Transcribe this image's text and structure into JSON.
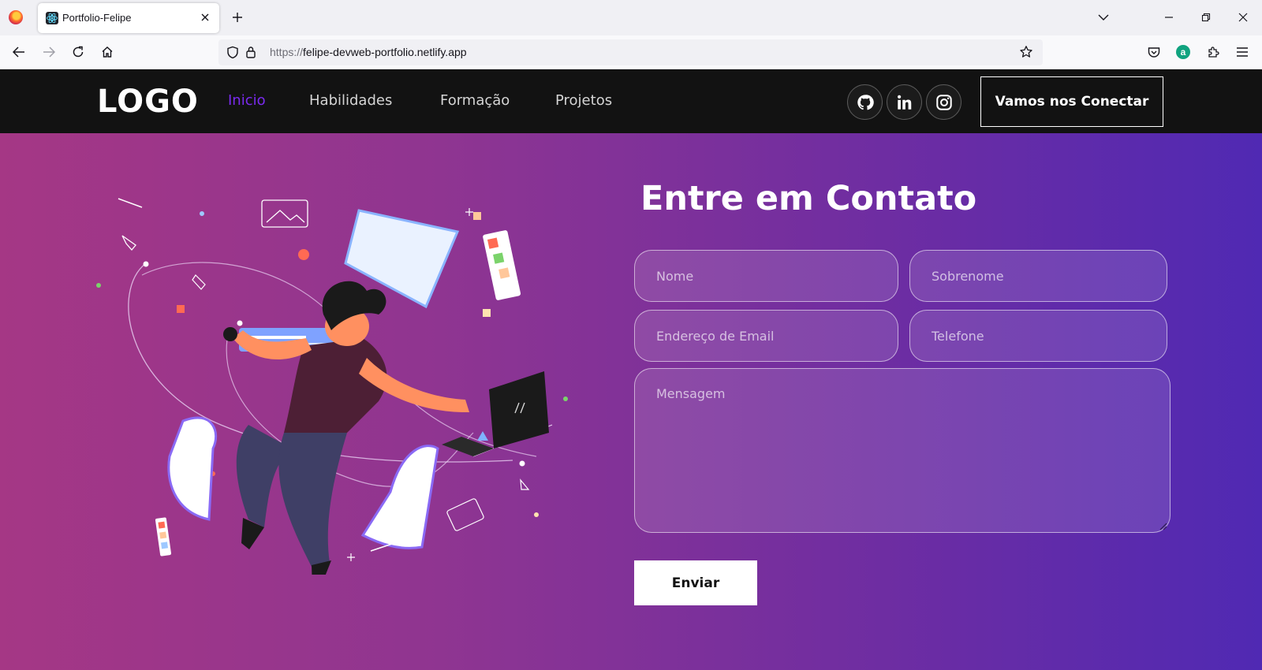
{
  "browser": {
    "tab_title": "Portfolio-Felipe",
    "url_protocol": "https://",
    "url_host": "felipe-devweb-portfolio.netlify.app",
    "extension_letter": "a"
  },
  "site": {
    "logo": "LOGO",
    "nav": [
      {
        "label": "Inicio",
        "active": true
      },
      {
        "label": "Habilidades",
        "active": false
      },
      {
        "label": "Formação",
        "active": false
      },
      {
        "label": "Projetos",
        "active": false
      }
    ],
    "social_icons": [
      "github-icon",
      "linkedin-icon",
      "instagram-icon"
    ],
    "connect_label": "Vamos nos Conectar",
    "accent_color": "#7b2bf0"
  },
  "contact": {
    "title": "Entre em Contato",
    "fields": {
      "first_name": "Nome",
      "last_name": "Sobrenome",
      "email": "Endereço de Email",
      "phone": "Telefone",
      "message": "Mensagem"
    },
    "submit_label": "Enviar",
    "gradient": [
      "#a53785",
      "#5029b3"
    ]
  }
}
